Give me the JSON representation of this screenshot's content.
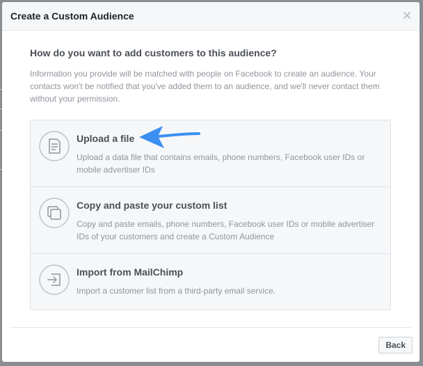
{
  "dialog": {
    "title": "Create a Custom Audience",
    "close_icon": "close-icon"
  },
  "main": {
    "question": "How do you want to add customers to this audience?",
    "info": "Information you provide will be matched with people on Facebook to create an audience. Your contacts won't be notified that you've added them to an audience, and we'll never contact them without your permission."
  },
  "options": [
    {
      "icon": "document-icon",
      "title": "Upload a file",
      "description": "Upload a data file that contains emails, phone numbers, Facebook user IDs or mobile advertiser IDs"
    },
    {
      "icon": "copy-icon",
      "title": "Copy and paste your custom list",
      "description": "Copy and paste emails, phone numbers, Facebook user IDs or mobile advertiser IDs of your customers and create a Custom Audience"
    },
    {
      "icon": "import-icon",
      "title": "Import from MailChimp",
      "description": "Import a customer list from a third-party email service."
    }
  ],
  "footer": {
    "back_label": "Back"
  },
  "colors": {
    "accent_arrow": "#3b8ff0",
    "title_text": "#4b4f56",
    "muted_text": "#90949c"
  }
}
